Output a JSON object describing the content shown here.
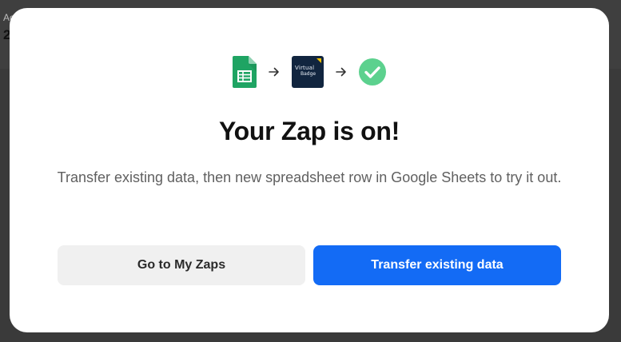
{
  "background": {
    "label": "Ac",
    "value": "2"
  },
  "flow": {
    "steps": [
      {
        "icon": "google-sheets-icon"
      },
      {
        "icon": "arrow-right-icon"
      },
      {
        "icon": "virtual-badge-logo",
        "logo_text_line1": "Virtual",
        "logo_text_line2": "Badge"
      },
      {
        "icon": "arrow-right-icon"
      },
      {
        "icon": "check-circle-icon"
      }
    ],
    "colors": {
      "sheets_green": "#1fa463",
      "badge_navy": "#11253f",
      "check_green": "#5cd18e"
    }
  },
  "modal": {
    "title": "Your Zap is on!",
    "description": "Transfer existing data, then new spreadsheet row in Google Sheets to try it out.",
    "secondary_button": "Go to My Zaps",
    "primary_button": "Transfer existing data",
    "colors": {
      "primary": "#136bf5",
      "secondary_bg": "#f0f0f0"
    }
  }
}
